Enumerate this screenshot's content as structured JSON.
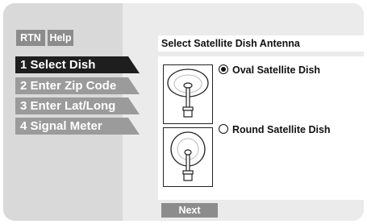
{
  "header": {
    "rtn_label": "RTN",
    "help_label": "Help"
  },
  "steps": [
    {
      "label": "1 Select Dish",
      "state": "active"
    },
    {
      "label": "2 Enter Zip Code",
      "state": "inactive"
    },
    {
      "label": "3 Enter Lat/Long",
      "state": "inactive"
    },
    {
      "label": "4 Signal Meter",
      "state": "inactive"
    }
  ],
  "main": {
    "title": "Select Satellite Dish Antenna",
    "options": [
      {
        "label": "Oval Satellite Dish",
        "selected": true,
        "icon": "oval-dish-icon"
      },
      {
        "label": "Round Satellite Dish",
        "selected": false,
        "icon": "round-dish-icon"
      }
    ],
    "next_label": "Next"
  },
  "colors": {
    "active_step": "#1e1e1e",
    "inactive_step": "#9b9b9b",
    "button_gray": "#8c8c8c",
    "screen_bg": "#d9d9d9"
  }
}
